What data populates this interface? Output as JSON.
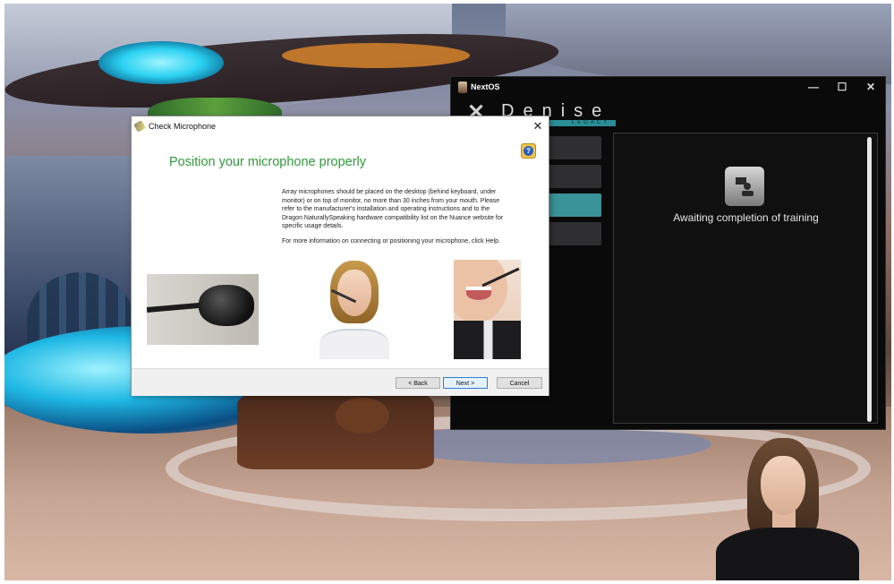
{
  "dialog": {
    "title": "Check Microphone",
    "close_label": "✕",
    "help_label": "?",
    "heading": "Position your microphone properly",
    "paragraph1": "Array microphones should be placed on the desktop (behind keyboard, under monitor) or on top of monitor, no more than 30 inches from your mouth.  Please refer to the manufacturer's installation and operating instructions and to the Dragon NaturallySpeaking hardware compatibility list on the Nuance website for specific usage details.",
    "paragraph2": "For more information on connecting or positioning your microphone, click Help.",
    "buttons": {
      "back": "< Back",
      "next": "Next >",
      "cancel": "Cancel"
    },
    "images": [
      "microphone-closeup",
      "woman-with-headset",
      "smiling-woman-headset"
    ]
  },
  "nextos": {
    "title": "NextOS",
    "minimize": "—",
    "maximize": "☐",
    "close": "✕",
    "logo_name": "Denise",
    "logo_sub": "LEGACY",
    "menu_items": [
      "",
      "",
      "",
      ""
    ],
    "status_text": "Awaiting completion of training",
    "status_icon": "training-icon",
    "accent_color": "#3a9398"
  }
}
